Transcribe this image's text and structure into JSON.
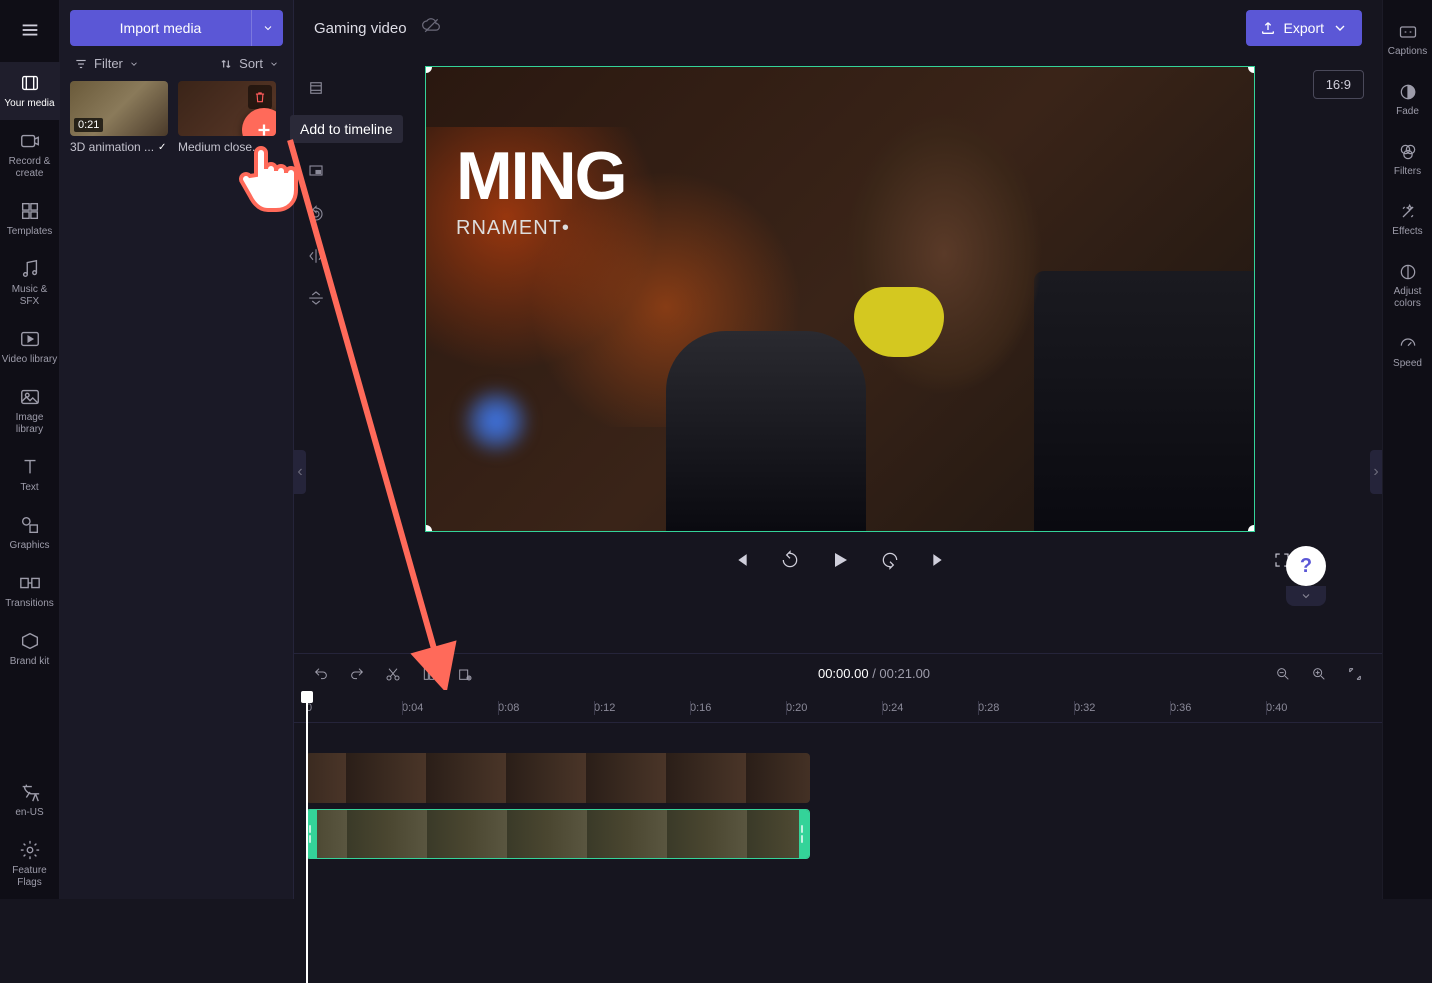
{
  "project_name": "Gaming video",
  "import_label": "Import media",
  "filter_label": "Filter",
  "sort_label": "Sort",
  "export_label": "Export",
  "aspect_ratio": "16:9",
  "tooltip_add": "Add to timeline",
  "scene_big_text": "MING",
  "scene_sub_text": "RNAMENT•",
  "timecode": {
    "current": "00:00.00",
    "total": "00:21.00",
    "sep": " / "
  },
  "ruler_ticks": [
    "0",
    "0:04",
    "0:08",
    "0:12",
    "0:16",
    "0:20",
    "0:24",
    "0:28",
    "0:32",
    "0:36",
    "0:40"
  ],
  "media": [
    {
      "duration": "0:21",
      "title": "3D animation ...",
      "used": true
    },
    {
      "duration": "",
      "title": "Medium close...",
      "used": false
    }
  ],
  "left_rail": [
    {
      "label": "Your media",
      "icon": "media"
    },
    {
      "label": "Record & create",
      "icon": "record"
    },
    {
      "label": "Templates",
      "icon": "templates"
    },
    {
      "label": "Music & SFX",
      "icon": "music"
    },
    {
      "label": "Video library",
      "icon": "videolib"
    },
    {
      "label": "Image library",
      "icon": "imagelib"
    },
    {
      "label": "Text",
      "icon": "text"
    },
    {
      "label": "Graphics",
      "icon": "graphics"
    },
    {
      "label": "Transitions",
      "icon": "transitions"
    },
    {
      "label": "Brand kit",
      "icon": "brand"
    }
  ],
  "left_rail_bottom": [
    {
      "label": "en-US",
      "icon": "lang"
    },
    {
      "label": "Feature Flags",
      "icon": "flags"
    }
  ],
  "right_rail": [
    {
      "label": "Captions",
      "icon": "captions"
    },
    {
      "label": "Fade",
      "icon": "fade"
    },
    {
      "label": "Filters",
      "icon": "filters"
    },
    {
      "label": "Effects",
      "icon": "effects"
    },
    {
      "label": "Adjust colors",
      "icon": "adjust"
    },
    {
      "label": "Speed",
      "icon": "speed"
    }
  ]
}
